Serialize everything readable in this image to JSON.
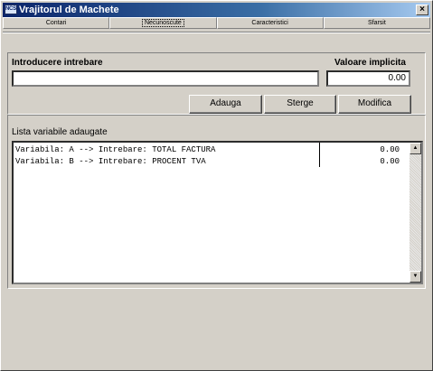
{
  "window": {
    "title": "Vrajitorul de Machete",
    "icon": "app-window-icon",
    "icon_text": "NCSM",
    "close_glyph": "×"
  },
  "tabs": [
    {
      "label": "Contari",
      "active": false
    },
    {
      "label": "Necunoscute",
      "active": true
    },
    {
      "label": "Caracteristici",
      "active": false
    },
    {
      "label": "Sfarsit",
      "active": false
    }
  ],
  "form": {
    "question_label": "Introducere intrebare",
    "question_value": "",
    "default_label": "Valoare implicita",
    "default_value": "0.00"
  },
  "buttons": {
    "add": "Adauga",
    "delete": "Sterge",
    "modify": "Modifica"
  },
  "list": {
    "title": "Lista variabile adaugate",
    "rows": [
      {
        "question": "Variabila: A --> Intrebare: TOTAL FACTURA",
        "value": "0.00"
      },
      {
        "question": "Variabila: B --> Intrebare: PROCENT TVA",
        "value": "0.00"
      }
    ],
    "scroll_up_glyph": "▲",
    "scroll_down_glyph": "▼"
  },
  "colors": {
    "title_bar_start": "#0a246a",
    "title_bar_end": "#a6caf0",
    "face": "#d4d0c8"
  }
}
